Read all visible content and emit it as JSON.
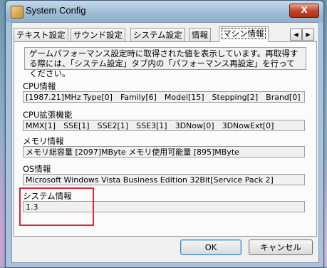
{
  "window": {
    "title": "System Config",
    "close_label": "X"
  },
  "tabs": [
    {
      "label": "テキスト設定"
    },
    {
      "label": "サウンド設定"
    },
    {
      "label": "システム設定"
    },
    {
      "label": "情報"
    },
    {
      "label": "マシン情報"
    }
  ],
  "tab_scroll": {
    "left": "◀",
    "right": "▶"
  },
  "description": "ゲームパフォーマンス設定時に取得された値を表示しています。再取得する際には、「システム設定」タブ内の「パフォーマンス再設定」を行ってください。",
  "sections": {
    "cpu": {
      "label": "CPU情報",
      "value": "[1987.21]MHz Type[0]　Family[6]　Model[15]　Stepping[2]　Brand[0]"
    },
    "cpu_ext": {
      "label": "CPU拡張機能",
      "value": "MMX[1]　SSE[1]　SSE2[1]　SSE3[1]　3DNow[0]　3DNowExt[0]"
    },
    "memory": {
      "label": "メモリ情報",
      "value": "メモリ総容量 [2097]MByte メモリ使用可能量 [895]MByte"
    },
    "os": {
      "label": "OS情報",
      "value": "Microsoft Windows Vista Business Edition 32Bit[Service Pack 2]"
    },
    "system": {
      "label": "システム情報",
      "value": "1.3"
    }
  },
  "buttons": {
    "ok": "OK",
    "cancel": "キャンセル"
  },
  "colors": {
    "highlight": "#d9272e",
    "titlebar": "#9fbcd6"
  }
}
